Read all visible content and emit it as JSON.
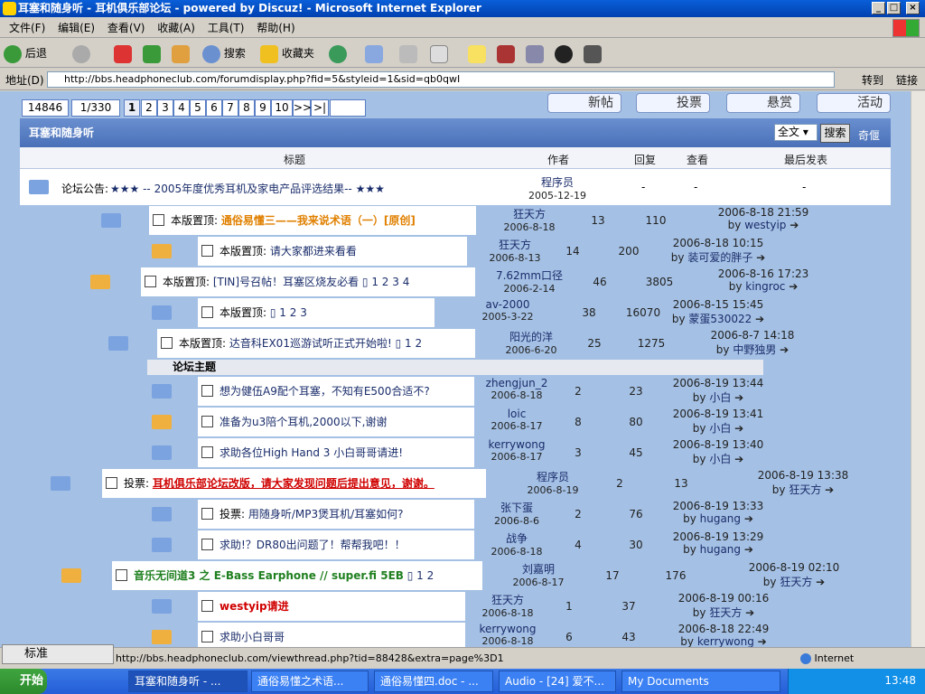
{
  "window": {
    "title": "耳塞和随身听 - 耳机俱乐部论坛 - powered by Discuz! - Microsoft Internet Explorer"
  },
  "menu": [
    "文件(F)",
    "编辑(E)",
    "查看(V)",
    "收藏(A)",
    "工具(T)",
    "帮助(H)"
  ],
  "toolbar": {
    "back": "后退",
    "search": "搜索",
    "favorites": "收藏夹"
  },
  "address": {
    "label": "地址(D)",
    "url": "http://bbs.headphoneclub.com/forumdisplay.php?fid=5&styleid=1&sid=qb0qwI",
    "go": "转到",
    "links": "链接"
  },
  "pager": {
    "total": "14846",
    "page": "1/330",
    "pages": [
      "1",
      "2",
      "3",
      "4",
      "5",
      "6",
      "7",
      "8",
      "9",
      "10"
    ],
    "next": ">>",
    "last": ">|"
  },
  "buttons": {
    "new_post": "新帖",
    "poll": "投票",
    "reward": "悬赏",
    "event": "活动"
  },
  "forum": {
    "name": "耳塞和随身听",
    "search_scope": "全文",
    "search_btn": "搜索",
    "adv_search": "奇偃"
  },
  "columns": {
    "title": "标题",
    "author": "作者",
    "replies": "回复",
    "views": "查看",
    "last": "最后发表"
  },
  "announcement": {
    "label": "论坛公告:",
    "title": "★★★ -- 2005年度优秀耳机及家电产品评选结果-- ★★★",
    "author": "程序员",
    "date": "2005-12-19",
    "replies": "-",
    "views": "-",
    "last": "-"
  },
  "section": "论坛主题",
  "threads": [
    {
      "prefix": "本版置顶:",
      "title": "通俗易懂三——我来说术语（一）[原创]",
      "author": "狂天方",
      "date": "2006-8-18",
      "replies": "13",
      "views": "110",
      "last_time": "2006-8-18 21:59",
      "last_by": "westyip",
      "color": "#e08000",
      "pages": ""
    },
    {
      "prefix": "本版置顶:",
      "title": "请大家都进来看看",
      "author": "狂天方",
      "date": "2006-8-13",
      "replies": "14",
      "views": "200",
      "last_time": "2006-8-18 10:15",
      "last_by": "装可爱的胖子",
      "color": "#1a2d6b",
      "pages": ""
    },
    {
      "prefix": "本版置顶:",
      "title": "[TIN]号召帖！耳塞区烧友必看",
      "author": "7.62mm口径",
      "date": "2006-2-14",
      "replies": "46",
      "views": "3805",
      "last_time": "2006-8-16 17:23",
      "last_by": "kingroc",
      "color": "#1a2d6b",
      "pages": "1 2 3 4"
    },
    {
      "prefix": "本版置顶:",
      "title": "",
      "author": "av-2000",
      "date": "2005-3-22",
      "replies": "38",
      "views": "16070",
      "last_time": "2006-8-15 15:45",
      "last_by": "蒙蛋530022",
      "color": "#1a2d6b",
      "pages": "1 2 3"
    },
    {
      "prefix": "本版置顶:",
      "title": "达音科EX01巡游试听正式开始啦!",
      "author": "阳光的洋",
      "date": "2006-6-20",
      "replies": "25",
      "views": "1275",
      "last_time": "2006-8-7 14:18",
      "last_by": "中野独男",
      "color": "#1a2d6b",
      "pages": "1 2"
    },
    {
      "prefix": "",
      "title": "想为健伍A9配个耳塞，不知有E500合适不?",
      "author": "zhengjun_2",
      "date": "2006-8-18",
      "replies": "2",
      "views": "23",
      "last_time": "2006-8-19 13:44",
      "last_by": "小白",
      "color": "#1a2d6b",
      "pages": ""
    },
    {
      "prefix": "",
      "title": "准备为u3陪个耳机,2000以下,谢谢",
      "author": "loic",
      "date": "2006-8-17",
      "replies": "8",
      "views": "80",
      "last_time": "2006-8-19 13:41",
      "last_by": "小白",
      "color": "#1a2d6b",
      "pages": ""
    },
    {
      "prefix": "",
      "title": "求助各位High Hand 3 小白哥哥请进!",
      "author": "kerrywong",
      "date": "2006-8-17",
      "replies": "3",
      "views": "45",
      "last_time": "2006-8-19 13:40",
      "last_by": "小白",
      "color": "#1a2d6b",
      "pages": ""
    },
    {
      "prefix": "投票:",
      "title": "耳机俱乐部论坛改版，请大家发现问题后提出意见，谢谢。",
      "author": "程序员",
      "date": "2006-8-19",
      "replies": "2",
      "views": "13",
      "last_time": "2006-8-19 13:38",
      "last_by": "狂天方",
      "color": "#d00000",
      "pages": ""
    },
    {
      "prefix": "投票:",
      "title": "用随身听/MP3煲耳机/耳塞如何?",
      "author": "张下蛋",
      "date": "2006-8-6",
      "replies": "2",
      "views": "76",
      "last_time": "2006-8-19 13:33",
      "last_by": "hugang",
      "color": "#1a2d6b",
      "pages": ""
    },
    {
      "prefix": "",
      "title": "求助!？DR80出问题了！帮帮我吧！！",
      "author": "战争",
      "date": "2006-8-18",
      "replies": "4",
      "views": "30",
      "last_time": "2006-8-19 13:29",
      "last_by": "hugang",
      "color": "#1a2d6b",
      "pages": ""
    },
    {
      "prefix": "",
      "title": "音乐无间道3 之 E-Bass Earphone // super.fi 5EB",
      "author": "刘嘉明",
      "date": "2006-8-17",
      "replies": "17",
      "views": "176",
      "last_time": "2006-8-19 02:10",
      "last_by": "狂天方",
      "color": "#208020",
      "pages": "1 2"
    },
    {
      "prefix": "",
      "title": "westyip请进",
      "author": "狂天方",
      "date": "2006-8-18",
      "replies": "1",
      "views": "37",
      "last_time": "2006-8-19 00:16",
      "last_by": "狂天方",
      "color": "#d00000",
      "pages": ""
    },
    {
      "prefix": "",
      "title": "求助小白哥哥",
      "author": "kerrywong",
      "date": "2006-8-18",
      "replies": "6",
      "views": "43",
      "last_time": "2006-8-18 22:49",
      "last_by": "kerrywong",
      "color": "#1a2d6b",
      "pages": ""
    }
  ],
  "status": {
    "text": "http://bbs.headphoneclub.com/viewthread.php?tid=88428&extra=page%3D1",
    "zone": "Internet"
  },
  "ime": {
    "label": "标准"
  },
  "taskbar": {
    "start": "开始",
    "tasks": [
      "耳塞和随身听 - ...",
      "通俗易懂之术语...",
      "通俗易懂四.doc - ...",
      "Audio - [24] 爱不...",
      "My Documents"
    ],
    "clock": "13:48"
  }
}
